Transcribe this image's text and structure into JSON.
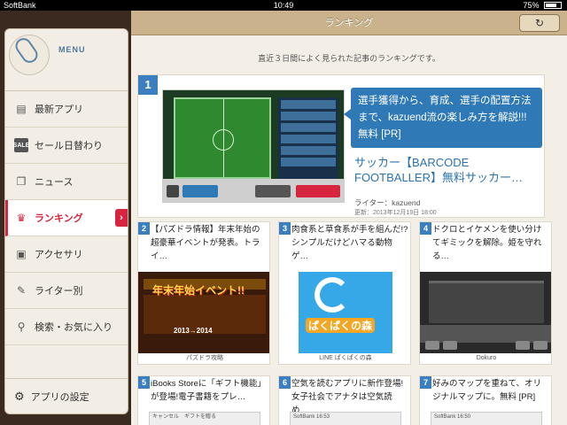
{
  "status": {
    "carrier": "SoftBank",
    "time": "10:49",
    "battery": "75%",
    "battery_fraction": 0.75
  },
  "sidebar": {
    "menu_label": "MENU",
    "items": [
      {
        "label": "最新アプリ",
        "icon": "app-icon"
      },
      {
        "label": "セール日替わり",
        "icon": "sale-icon"
      },
      {
        "label": "ニュース",
        "icon": "news-icon"
      },
      {
        "label": "ランキング",
        "icon": "crown-icon",
        "active": true
      },
      {
        "label": "アクセサリ",
        "icon": "accessory-icon"
      },
      {
        "label": "ライター別",
        "icon": "pencil-icon"
      },
      {
        "label": "検索・お気に入り",
        "icon": "search-icon"
      }
    ],
    "settings_label": "アプリの設定"
  },
  "header": {
    "title": "ランキング"
  },
  "main": {
    "subtitle": "直近３日間によく見られた記事のランキングです。",
    "featured": {
      "rank": "1",
      "bubble": "選手獲得から、育成、選手の配置方法まで、kazuend流の楽しみ方を解説!!!無料 [PR]",
      "title": "サッカー【BARCODE FOOTBALLER】無料サッカー…",
      "writer": "ライター：kazuend",
      "updated": "更新：2013年12月19日 18:00"
    },
    "cards": [
      {
        "rank": "2",
        "title": "【パズドラ情報】年末年始の超豪華イベントが発表。トライ…",
        "caption": "パズドラ攻略",
        "banner": "年末年始イベント!!",
        "banner_year": "2013→2014"
      },
      {
        "rank": "3",
        "title": "肉食系と草食系が手を組んだ!?シンプルだけどハマる動物ゲ…",
        "caption": "LINE ぱくぱくの森",
        "banner": "ぱくぱくの森"
      },
      {
        "rank": "4",
        "title": "ドクロとイケメンを使い分けてギミックを解除。姫を守れる…",
        "caption": "Dokuro"
      },
      {
        "rank": "5",
        "title": "iBooks Storeに「ギフト機能」が登場!電子書籍をプレ…",
        "strip": "キャンセル　ギフトを贈る"
      },
      {
        "rank": "6",
        "title": "空気を読むアプリに新作登場!女子社会でアナタは空気読め…",
        "strip": "SoftBank 16:53"
      },
      {
        "rank": "7",
        "title": "好みのマップを重ねて、オリジナルマップに。無料 [PR]",
        "strip": "SoftBank 16:50"
      }
    ]
  },
  "colors": {
    "accent": "#d8253f",
    "rank_blue": "#3c7fc0",
    "link_blue": "#2b73b0"
  }
}
